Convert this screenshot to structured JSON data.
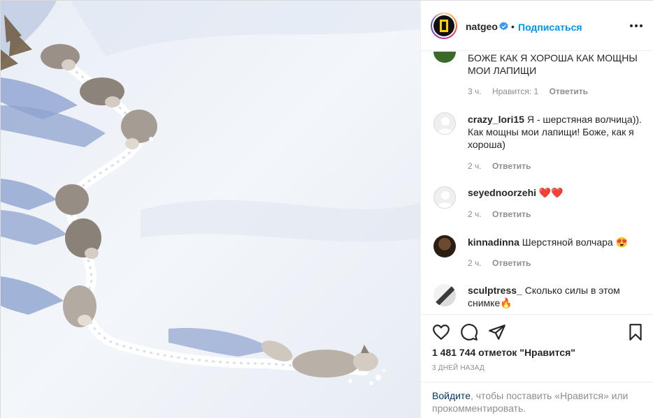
{
  "post": {
    "photo_alt": "",
    "header": {
      "username": "natgeo",
      "separator": "•",
      "follow_label": "Подписаться",
      "verified_icon": "verified-badge-icon",
      "more_icon": "more-options-icon"
    },
    "comments": [
      {
        "username": "",
        "text": "БОЖЕ КАК Я ХОРОША КАК МОЩНЫ МОИ ЛАПИЩИ",
        "time": "3 ч.",
        "likes": "Нравится: 1",
        "reply": "Ответить"
      },
      {
        "username": "crazy_lori15",
        "text": " Я - шерстяная волчица)). Как мощны мои лапищи! Боже, как я хороша)",
        "time": "2 ч.",
        "likes": "",
        "reply": "Ответить"
      },
      {
        "username": "seyednoorzehi",
        "text": " ❤️❤️",
        "time": "2 ч.",
        "likes": "",
        "reply": "Ответить"
      },
      {
        "username": "kinnadinna",
        "text": " Шерстяной волчара 😍",
        "time": "2 ч.",
        "likes": "",
        "reply": "Ответить"
      },
      {
        "username": "sculptress_",
        "text": " Сколько силы в этом снимке🔥",
        "time": "",
        "likes": "",
        "reply": ""
      }
    ],
    "actions": {
      "like_icon": "heart-icon",
      "comment_icon": "comment-icon",
      "share_icon": "paper-plane-icon",
      "save_icon": "bookmark-icon"
    },
    "likes_count": "1 481 744 отметок \"Нравится\"",
    "date": "3 ДНЕЙ НАЗАД",
    "login_prompt": {
      "link": "Войдите",
      "text": ", чтобы поставить «Нравится» или прокомментировать."
    }
  }
}
